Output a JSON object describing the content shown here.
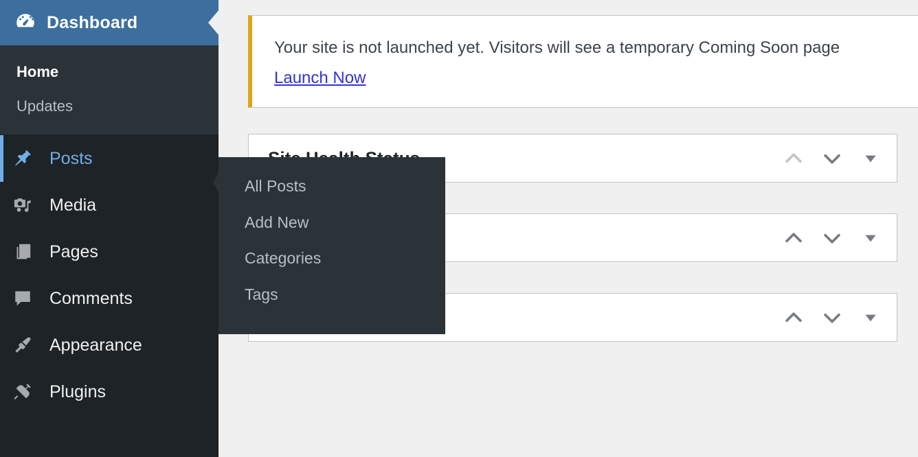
{
  "sidebar": {
    "header": {
      "label": "Dashboard",
      "icon": "dashboard-gauge-icon"
    },
    "dashboard_submenu": [
      {
        "label": "Home",
        "current": true
      },
      {
        "label": "Updates",
        "current": false
      }
    ],
    "items": [
      {
        "label": "Posts",
        "icon": "pushpin-icon",
        "active": true
      },
      {
        "label": "Media",
        "icon": "camera-music-icon",
        "active": false
      },
      {
        "label": "Pages",
        "icon": "pages-copy-icon",
        "active": false
      },
      {
        "label": "Comments",
        "icon": "speech-bubble-icon",
        "active": false
      },
      {
        "label": "Appearance",
        "icon": "paintbrush-icon",
        "active": false
      },
      {
        "label": "Plugins",
        "icon": "plug-icon",
        "active": false
      }
    ]
  },
  "flyout": {
    "items": [
      {
        "label": "All Posts"
      },
      {
        "label": "Add New"
      },
      {
        "label": "Categories"
      },
      {
        "label": "Tags"
      }
    ]
  },
  "notice": {
    "message": "Your site is not launched yet. Visitors will see a temporary Coming Soon page",
    "link_label": "Launch Now",
    "accent_color": "#dba617",
    "link_color": "#3232d8"
  },
  "panels": [
    {
      "title": "Site Health Status",
      "controls": {
        "move_up": "Move up",
        "move_down": "Move down",
        "toggle": "Toggle panel"
      },
      "move_up_enabled": false
    },
    {
      "title": "",
      "controls": {
        "move_up": "Move up",
        "move_down": "Move down",
        "toggle": "Toggle panel"
      },
      "move_up_enabled": true
    },
    {
      "title": "",
      "controls": {
        "move_up": "Move up",
        "move_down": "Move down",
        "toggle": "Toggle panel"
      },
      "move_up_enabled": true
    }
  ],
  "colors": {
    "sidebar_bg": "#1d2327",
    "submenu_bg": "#2c3338",
    "header_blue": "#3c6f9e",
    "active_accent": "#72aee6",
    "content_bg": "#f0f0f1",
    "panel_border": "#c3c4c7"
  }
}
